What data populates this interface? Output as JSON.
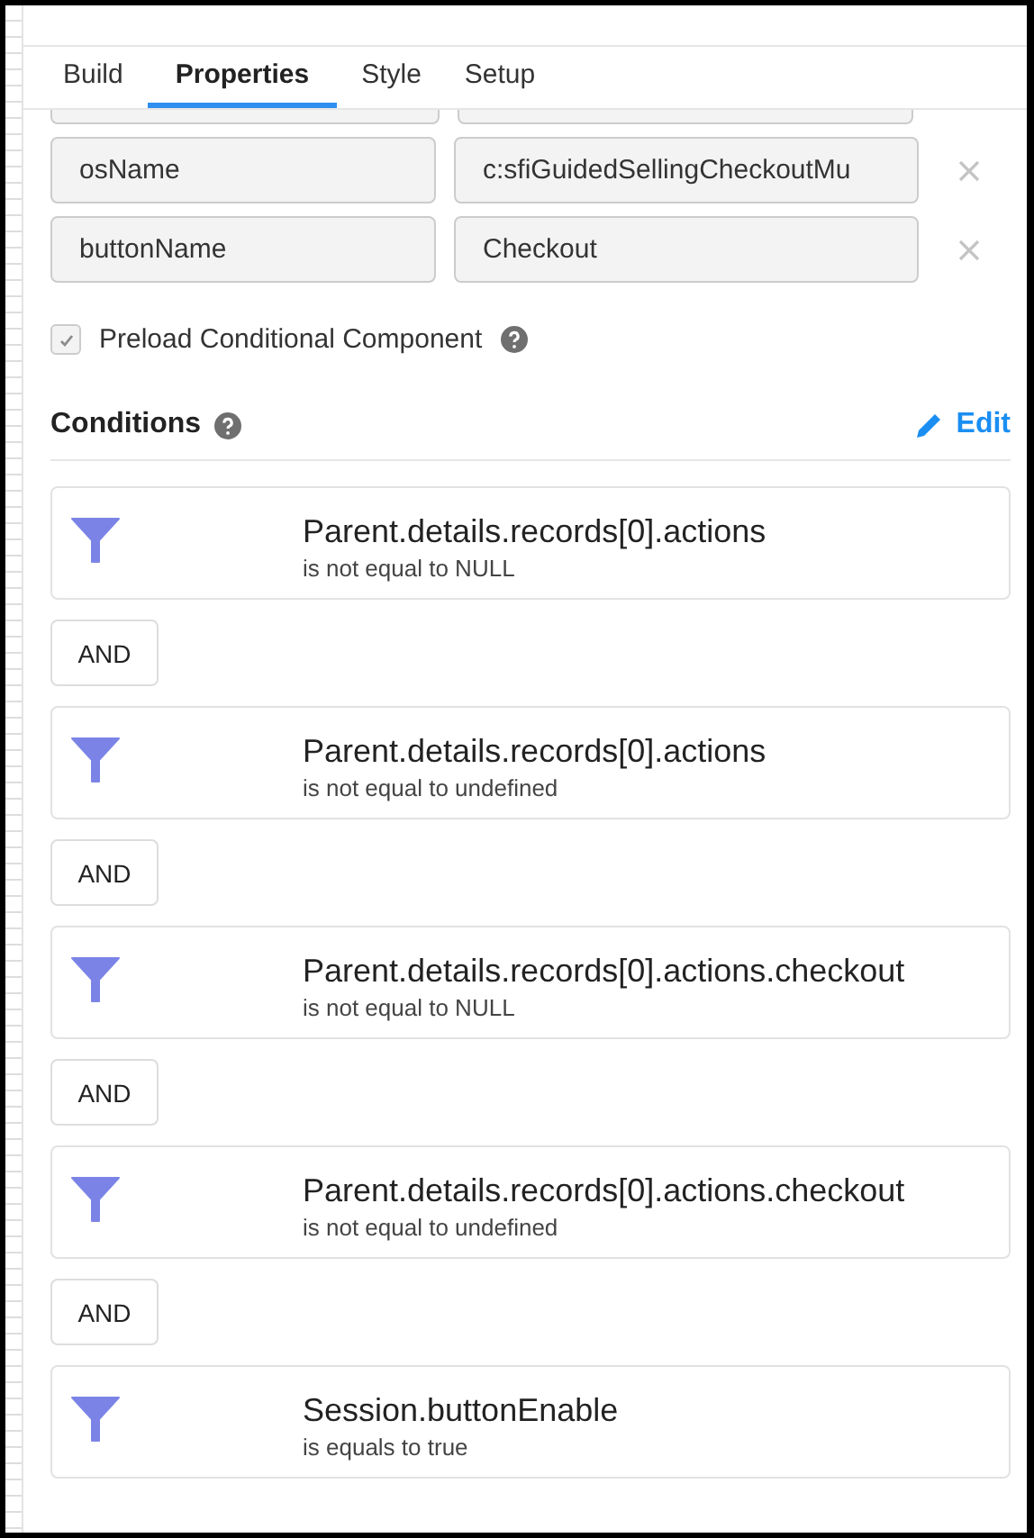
{
  "tabs": [
    {
      "label": "Build",
      "selected": false
    },
    {
      "label": "Properties",
      "selected": true
    },
    {
      "label": "Style",
      "selected": false
    },
    {
      "label": "Setup",
      "selected": false
    }
  ],
  "params": [
    {
      "key": "osName",
      "value": "c:sfiGuidedSellingCheckoutMu"
    },
    {
      "key": "buttonName",
      "value": "Checkout"
    }
  ],
  "preload": {
    "label": "Preload Conditional Component",
    "checked": true
  },
  "conditions_header": {
    "title": "Conditions",
    "edit": "Edit"
  },
  "conditions": [
    {
      "field": "Parent.details.records[0].actions",
      "rule": "is not equal to NULL"
    },
    {
      "field": "Parent.details.records[0].actions",
      "rule": "is not equal to undefined"
    },
    {
      "field": "Parent.details.records[0].actions.checkout",
      "rule": "is not equal to NULL"
    },
    {
      "field": "Parent.details.records[0].actions.checkout",
      "rule": "is not equal to undefined"
    },
    {
      "field": "Session.buttonEnable",
      "rule": "is equals to true"
    }
  ],
  "joiners": [
    "AND",
    "AND",
    "AND",
    "AND"
  ]
}
